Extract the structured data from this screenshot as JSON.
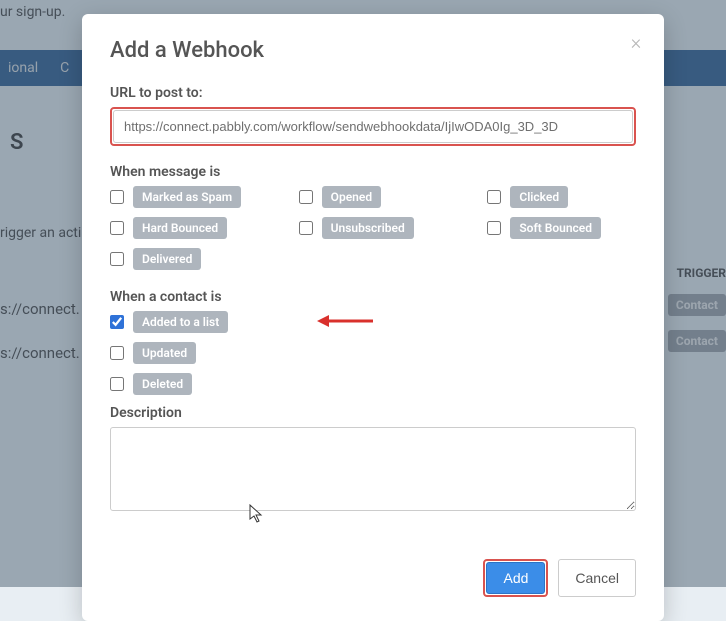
{
  "background": {
    "signup_fragment": "ur sign-up.",
    "nav_item_1": "ional",
    "nav_item_2": "C",
    "heading_char": "S",
    "trigger_fragment": "rigger an acti",
    "url_frag_1": "s://connect.",
    "url_frag_2": "s://connect.",
    "triggers_label": "TRIGGER",
    "contact_pill_1": "Contact",
    "contact_pill_2": "Contact"
  },
  "modal": {
    "title": "Add a Webhook",
    "url_label": "URL to post to:",
    "url_value": "https://connect.pabbly.com/workflow/sendwebhookdata/IjIwODA0Ig_3D_3D",
    "msg_label": "When message is",
    "contact_label": "When a contact is",
    "desc_label": "Description",
    "desc_value": "",
    "checkboxes": {
      "spam": "Marked as Spam",
      "hardbounce": "Hard Bounced",
      "delivered": "Delivered",
      "opened": "Opened",
      "unsub": "Unsubscribed",
      "clicked": "Clicked",
      "softbounce": "Soft Bounced",
      "added": "Added to a list",
      "updated": "Updated",
      "deleted": "Deleted"
    },
    "buttons": {
      "add": "Add",
      "cancel": "Cancel"
    }
  }
}
